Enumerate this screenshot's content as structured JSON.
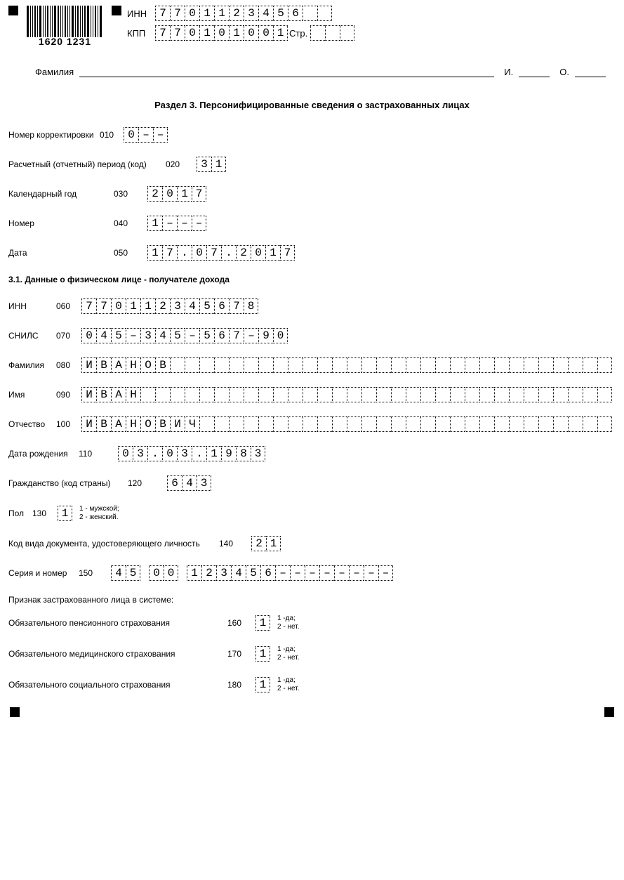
{
  "barcode_number": "1620 1231",
  "header": {
    "inn_label": "ИНН",
    "inn": "7701123456",
    "kpp_label": "КПП",
    "kpp": "770101001",
    "page_label": "Стр.",
    "page": "",
    "surname_label": "Фамилия",
    "i_label": "И.",
    "o_label": "О."
  },
  "section_title": "Раздел 3. Персонифицированные сведения о застрахованных лицах",
  "f010": {
    "label": "Номер корректировки",
    "code": "010",
    "value": "0--"
  },
  "f020": {
    "label": "Расчетный (отчетный) период (код)",
    "code": "020",
    "value": "31"
  },
  "f030": {
    "label": "Календарный год",
    "code": "030",
    "value": "2017"
  },
  "f040": {
    "label": "Номер",
    "code": "040",
    "value": "1---"
  },
  "f050": {
    "label": "Дата",
    "code": "050",
    "value": "17.07.2017"
  },
  "sub31": "3.1. Данные о физическом лице - получателе дохода",
  "f060": {
    "label": "ИНН",
    "code": "060",
    "value": "770112345678"
  },
  "f070": {
    "label": "СНИЛС",
    "code": "070",
    "value": "045-345-567-90"
  },
  "f080": {
    "label": "Фамилия",
    "code": "080",
    "value": "ИВАНОВ",
    "len": 36
  },
  "f090": {
    "label": "Имя",
    "code": "090",
    "value": "ИВАН",
    "len": 36
  },
  "f100": {
    "label": "Отчество",
    "code": "100",
    "value": "ИВАНОВИЧ",
    "len": 36
  },
  "f110": {
    "label": "Дата рождения",
    "code": "110",
    "value": "03.03.1983"
  },
  "f120": {
    "label": "Гражданство (код страны)",
    "code": "120",
    "value": "643"
  },
  "f130": {
    "label": "Пол",
    "code": "130",
    "value": "1",
    "hint": "1 - мужской;\n2 - женский."
  },
  "f140": {
    "label": "Код вида документа, удостоверяющего личность",
    "code": "140",
    "value": "21"
  },
  "f150": {
    "label": "Серия и номер",
    "code": "150",
    "groups": [
      "45",
      "00",
      "123456--------"
    ]
  },
  "sign_title": "Признак застрахованного лица в системе:",
  "f160": {
    "label": "Обязательного пенсионного страхования",
    "code": "160",
    "value": "1",
    "hint": "1 -да;\n2 - нет."
  },
  "f170": {
    "label": "Обязательного медицинского страхования",
    "code": "170",
    "value": "1",
    "hint": "1 -да;\n2 - нет."
  },
  "f180": {
    "label": "Обязательного социального страхования",
    "code": "180",
    "value": "1",
    "hint": "1 -да;\n2 - нет."
  }
}
